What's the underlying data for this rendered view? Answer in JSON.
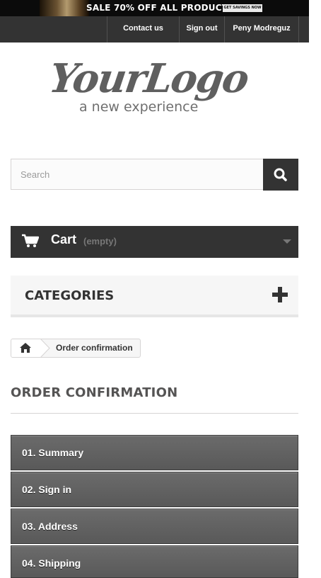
{
  "promo": {
    "text": "SALE 70% OFF ALL PRODUCTS",
    "cta": "GET SAVINGS NOW"
  },
  "nav": {
    "contact": "Contact us",
    "signout": "Sign out",
    "user": "Peny Modreguz"
  },
  "logo": {
    "main": "YourLogo",
    "tagline": "a new experience"
  },
  "search": {
    "placeholder": "Search",
    "icon": "search-icon"
  },
  "cart": {
    "label": "Cart",
    "status": "(empty)",
    "icon": "cart-icon"
  },
  "categories": {
    "title": "CATEGORIES",
    "toggle_icon": "plus-icon"
  },
  "breadcrumb": {
    "home_icon": "home-icon",
    "current": "Order confirmation"
  },
  "page": {
    "title": "ORDER CONFIRMATION"
  },
  "steps": [
    {
      "label": "01. Summary"
    },
    {
      "label": "02. Sign in"
    },
    {
      "label": "03. Address"
    },
    {
      "label": "04. Shipping"
    }
  ],
  "colors": {
    "dark_bar": "#333333",
    "step_bg": "#5f5f5f",
    "text_dark": "#333333"
  }
}
